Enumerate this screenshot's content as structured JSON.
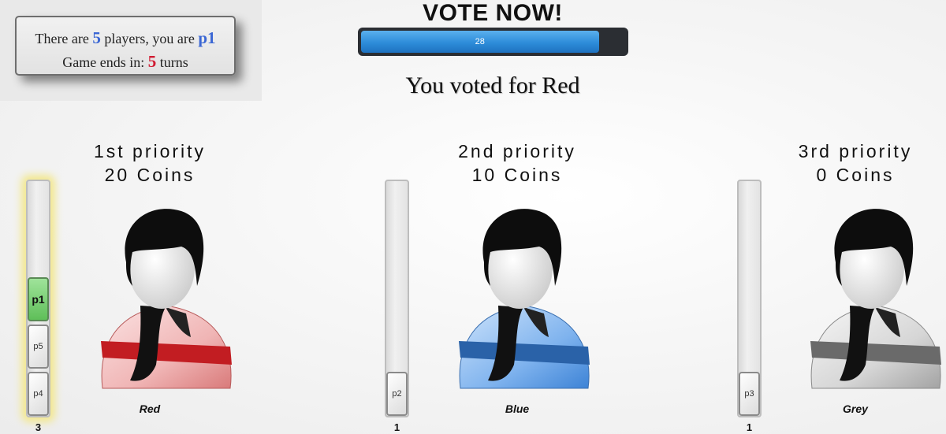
{
  "info": {
    "players_prefix": "There are",
    "player_count": "5",
    "players_mid": "players, you are",
    "player_id": "p1",
    "ends_prefix": "Game ends in:",
    "turns_left": "5",
    "turns_suffix": "turns"
  },
  "header": {
    "title": "VOTE NOW!",
    "timer_value": "28",
    "timer_fraction": 0.9,
    "voted_message": "You voted for Red"
  },
  "candidates": [
    {
      "priority": "1st priority",
      "coins": "20 Coins",
      "name": "Red",
      "color": "#d9262c",
      "vote_count": "3",
      "highlighted": true,
      "voters": [
        "p1",
        "p5",
        "p4"
      ]
    },
    {
      "priority": "2nd priority",
      "coins": "10 Coins",
      "name": "Blue",
      "color": "#2b7ad6",
      "vote_count": "1",
      "highlighted": false,
      "voters": [
        "p2"
      ]
    },
    {
      "priority": "3rd priority",
      "coins": "0 Coins",
      "name": "Grey",
      "color": "#8a8a8a",
      "vote_count": "1",
      "highlighted": false,
      "voters": [
        "p3"
      ]
    }
  ]
}
